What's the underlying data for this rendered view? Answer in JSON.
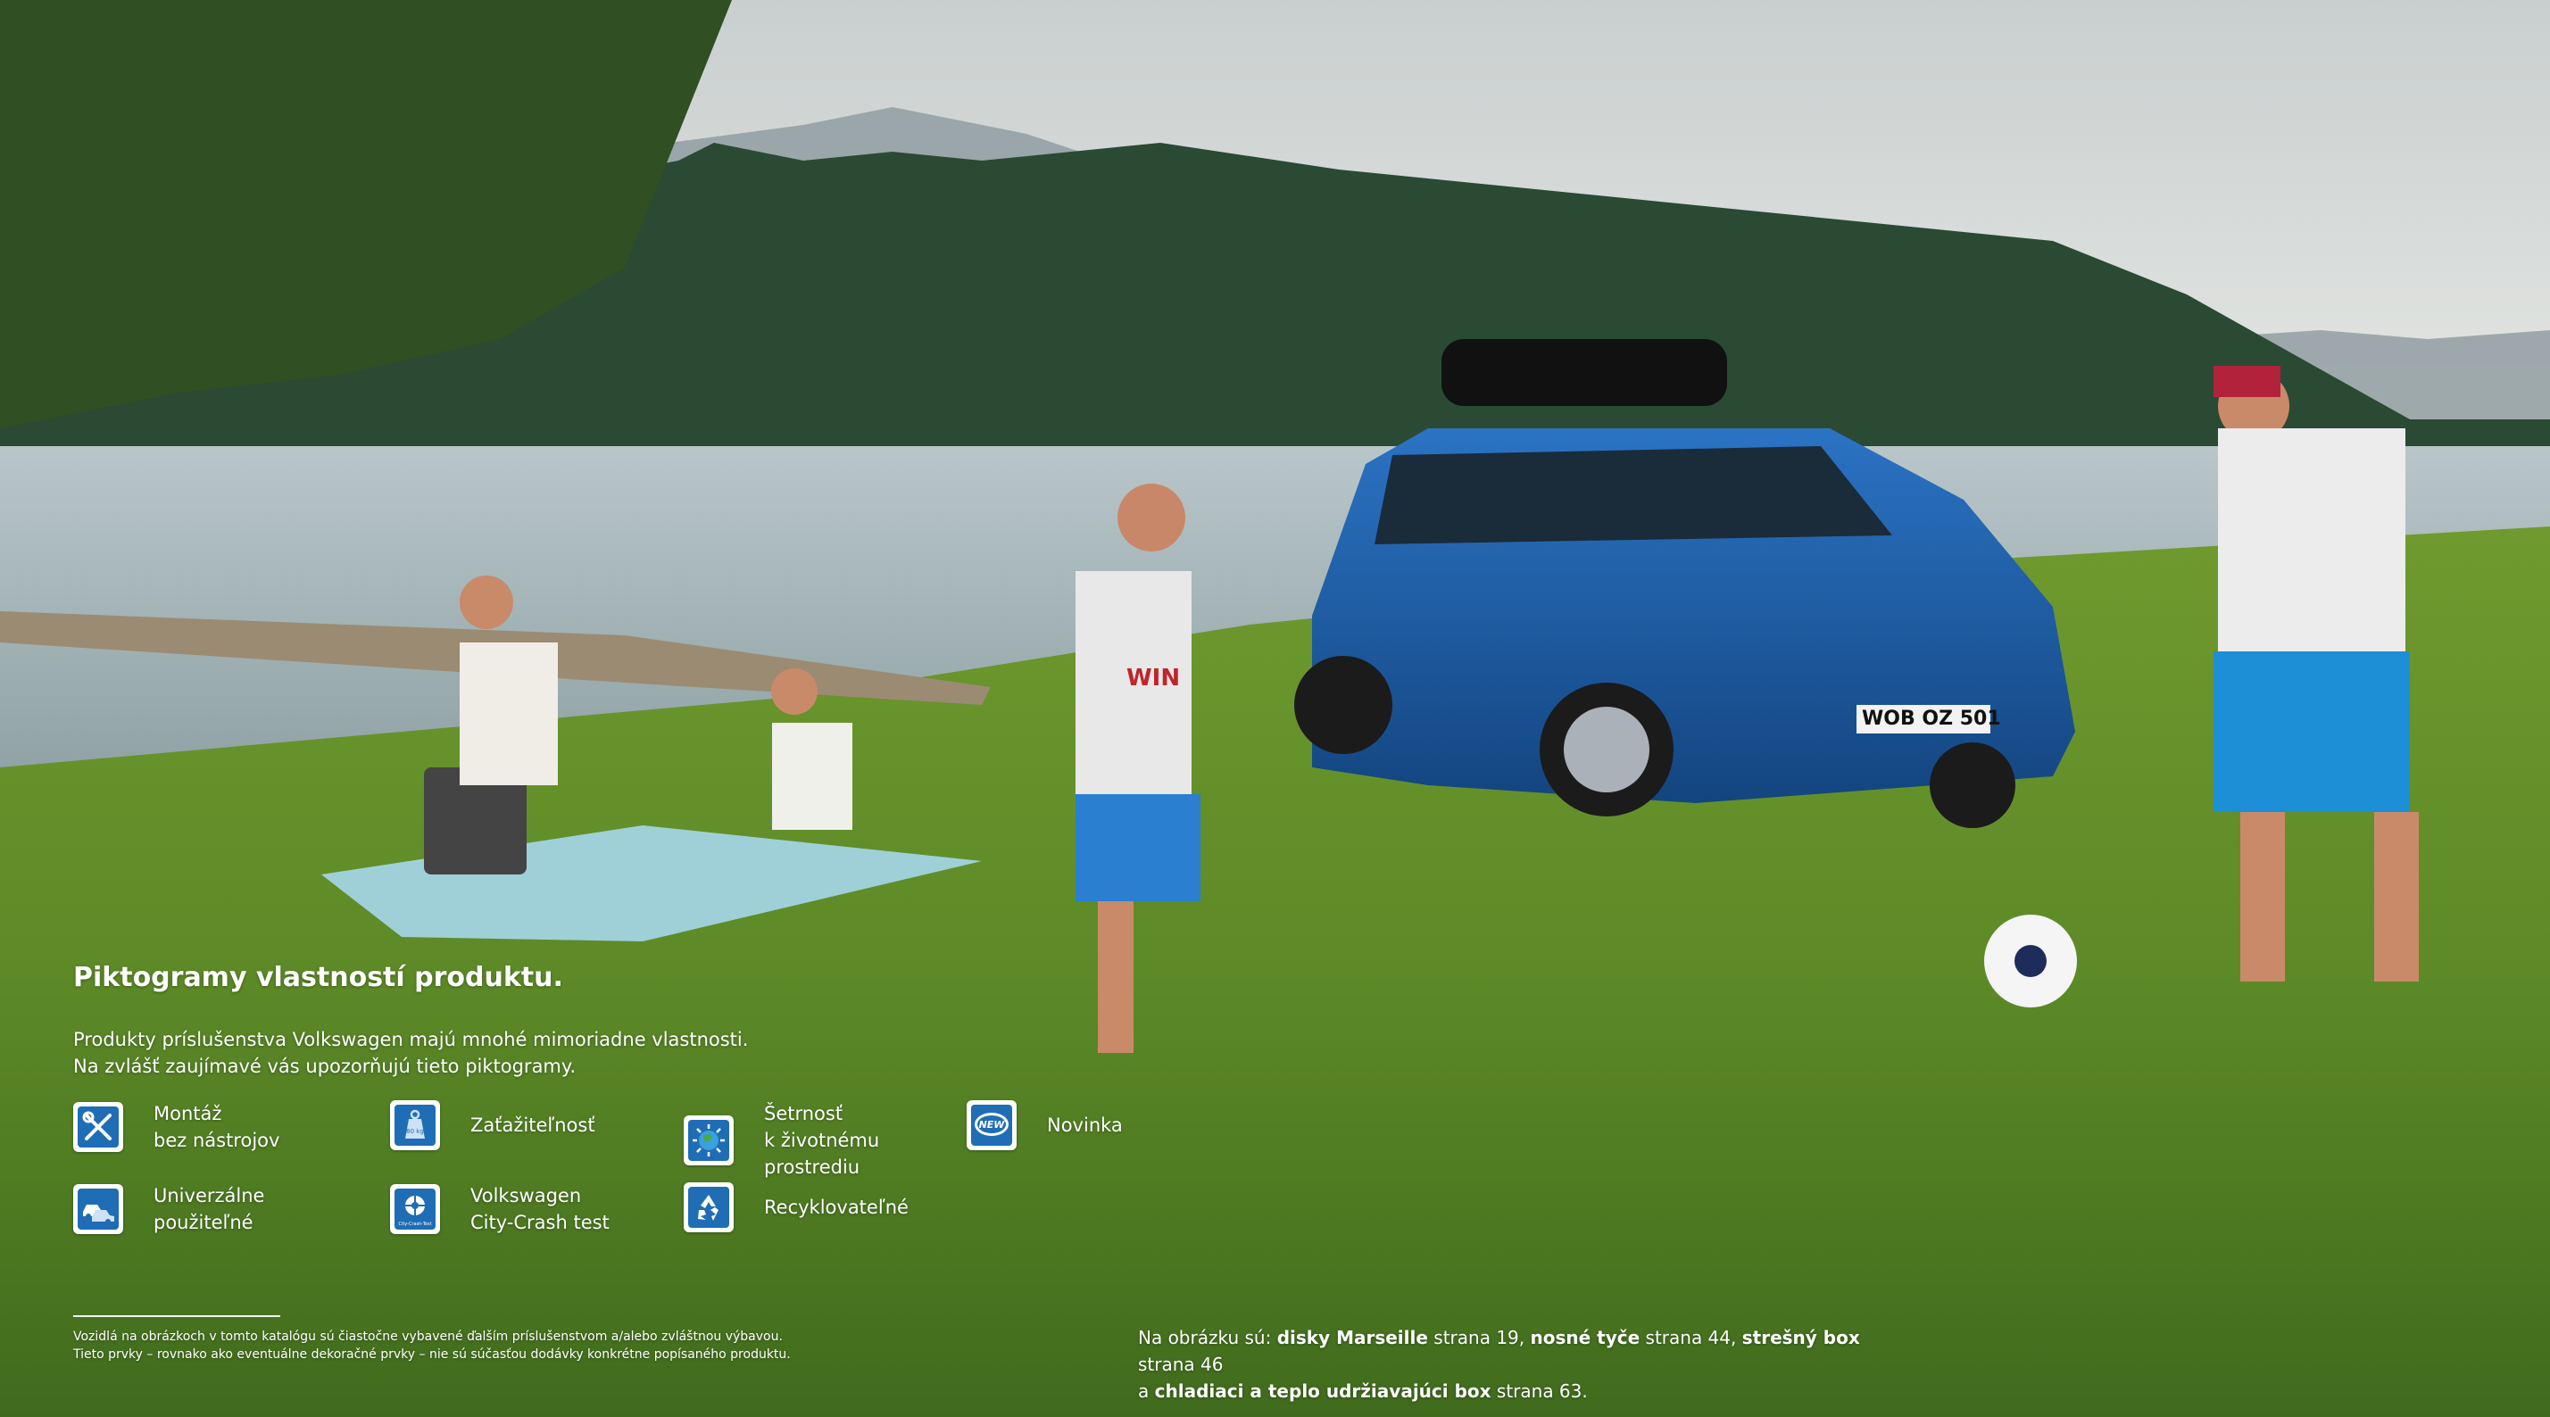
{
  "heading": "Piktogramy vlastností produktu.",
  "intro": {
    "line1": "Produkty príslušenstva Volkswagen majú mnohé mimoriadne vlastnosti.",
    "line2": "Na zvlášť zaujímavé vás upozorňujú tieto piktogramy."
  },
  "pictograms": [
    {
      "icon": "tools-crossed-icon",
      "label": "Montáž\nbez nástrojov"
    },
    {
      "icon": "weight-load-icon",
      "label": "Zaťažiteľnosť",
      "icon_text": "80 kg"
    },
    {
      "icon": "globe-environment-icon",
      "label": "Šetrnosť\nk životnému\nprostrediu"
    },
    {
      "icon": "new-badge-icon",
      "label": "Novinka",
      "icon_text": "NEW"
    },
    {
      "icon": "cars-universal-icon",
      "label": "Univerzálne\npoužiteľné"
    },
    {
      "icon": "crash-test-dummy-icon",
      "label": "Volkswagen\nCity-Crash test",
      "icon_text": "City-Crash-Test"
    },
    {
      "icon": "recycling-icon",
      "label": "Recyklovateľné"
    }
  ],
  "disclaimer": "Vozidlá na obrázkoch v tomto katalógu sú čiastočne vybavené ďalším príslušenstvom a/alebo zvláštnou výbavou.\nTieto prvky – rovnako ako eventuálne dekoračné prvky – nie sú súčasťou dodávky konkrétne popísaného produktu.",
  "caption": {
    "p1": "Na obrázku sú: ",
    "b1": "disky Marseille",
    "p2": " strana 19, ",
    "b2": "nosné tyče",
    "p3": " strana 44, ",
    "b3": "strešný box",
    "p4": " strana 46",
    "p5": "a ",
    "b4": "chladiaci a teplo udržiavajúci box",
    "p6": " strana 63."
  },
  "photo": {
    "license_plate": "WOB OZ 501",
    "shirt_text": "WIN"
  },
  "colors": {
    "icon_blue": "#1f6db5",
    "grass": "#5f8a2e",
    "lake": "#a8b8bd",
    "car_blue": "#1d5aa5"
  }
}
